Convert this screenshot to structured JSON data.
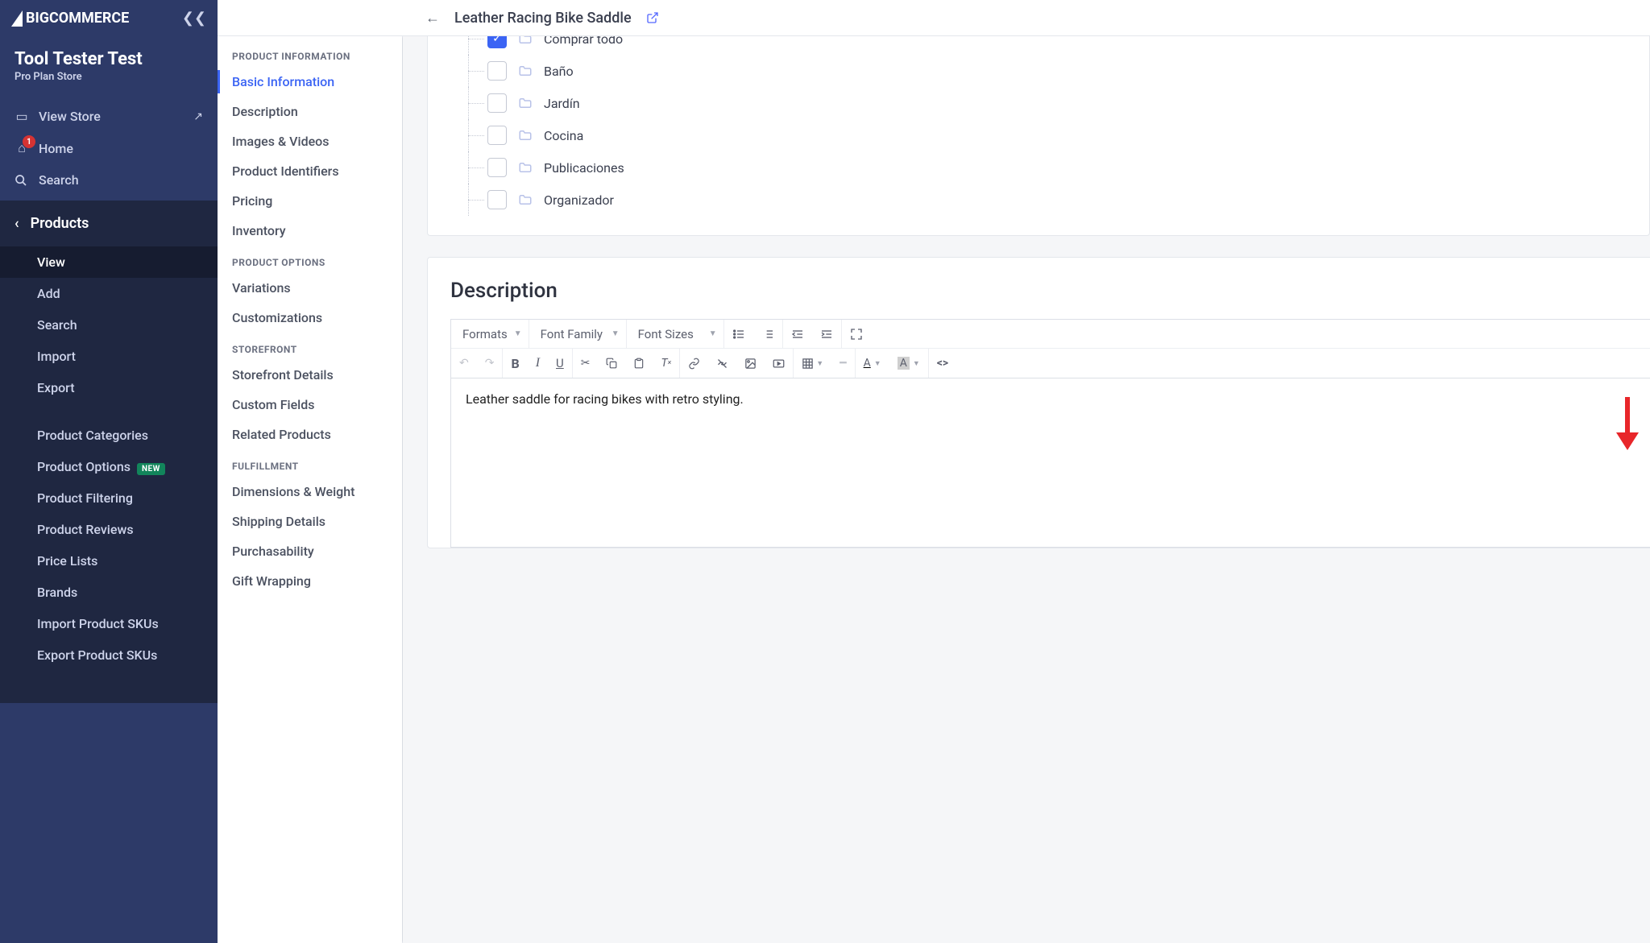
{
  "brand": {
    "name": "BIGCOMMERCE"
  },
  "store": {
    "name": "Tool Tester Test",
    "plan": "Pro Plan Store"
  },
  "nav": {
    "view_store": "View Store",
    "home": "Home",
    "home_badge": "1",
    "search": "Search",
    "section_title": "Products",
    "items": [
      {
        "label": "View",
        "active": true
      },
      {
        "label": "Add"
      },
      {
        "label": "Search"
      },
      {
        "label": "Import"
      },
      {
        "label": "Export"
      }
    ],
    "items2": [
      {
        "label": "Product Categories"
      },
      {
        "label": "Product Options",
        "new": true
      },
      {
        "label": "Product Filtering"
      },
      {
        "label": "Product Reviews"
      },
      {
        "label": "Price Lists"
      },
      {
        "label": "Brands"
      },
      {
        "label": "Import Product SKUs"
      },
      {
        "label": "Export Product SKUs"
      }
    ],
    "new_badge": "NEW"
  },
  "header": {
    "title": "Leather Racing Bike Saddle"
  },
  "section_nav": {
    "groups": [
      {
        "heading": "PRODUCT INFORMATION",
        "items": [
          {
            "label": "Basic Information",
            "active": true
          },
          {
            "label": "Description"
          },
          {
            "label": "Images & Videos"
          },
          {
            "label": "Product Identifiers"
          },
          {
            "label": "Pricing"
          },
          {
            "label": "Inventory"
          }
        ]
      },
      {
        "heading": "PRODUCT OPTIONS",
        "items": [
          {
            "label": "Variations"
          },
          {
            "label": "Customizations"
          }
        ]
      },
      {
        "heading": "STOREFRONT",
        "items": [
          {
            "label": "Storefront Details"
          },
          {
            "label": "Custom Fields"
          },
          {
            "label": "Related Products"
          }
        ]
      },
      {
        "heading": "FULFILLMENT",
        "items": [
          {
            "label": "Dimensions & Weight"
          },
          {
            "label": "Shipping Details"
          },
          {
            "label": "Purchasability"
          },
          {
            "label": "Gift Wrapping"
          }
        ]
      }
    ]
  },
  "categories": [
    {
      "label": "Comprar todo",
      "checked": true
    },
    {
      "label": "Baño",
      "checked": false
    },
    {
      "label": "Jardín",
      "checked": false
    },
    {
      "label": "Cocina",
      "checked": false
    },
    {
      "label": "Publicaciones",
      "checked": false
    },
    {
      "label": "Organizador",
      "checked": false
    }
  ],
  "description": {
    "heading": "Description",
    "formats": "Formats",
    "font_family": "Font Family",
    "font_sizes": "Font Sizes",
    "content": "Leather saddle for racing bikes with retro styling."
  }
}
